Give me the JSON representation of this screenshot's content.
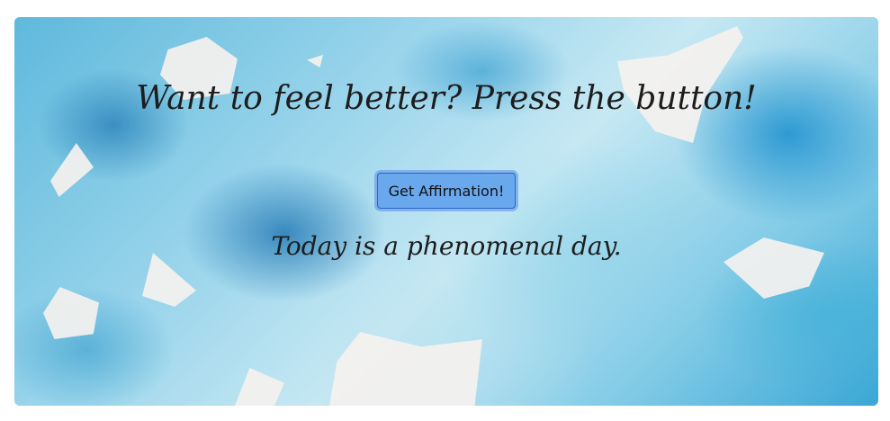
{
  "heading": "Want to feel better? Press the button!",
  "button_label": "Get Affirmation!",
  "affirmation": "Today is a phenomenal day.",
  "colors": {
    "button_bg": "#6aa8ee",
    "button_border": "#2b63c9",
    "text": "#1d1d1d"
  }
}
